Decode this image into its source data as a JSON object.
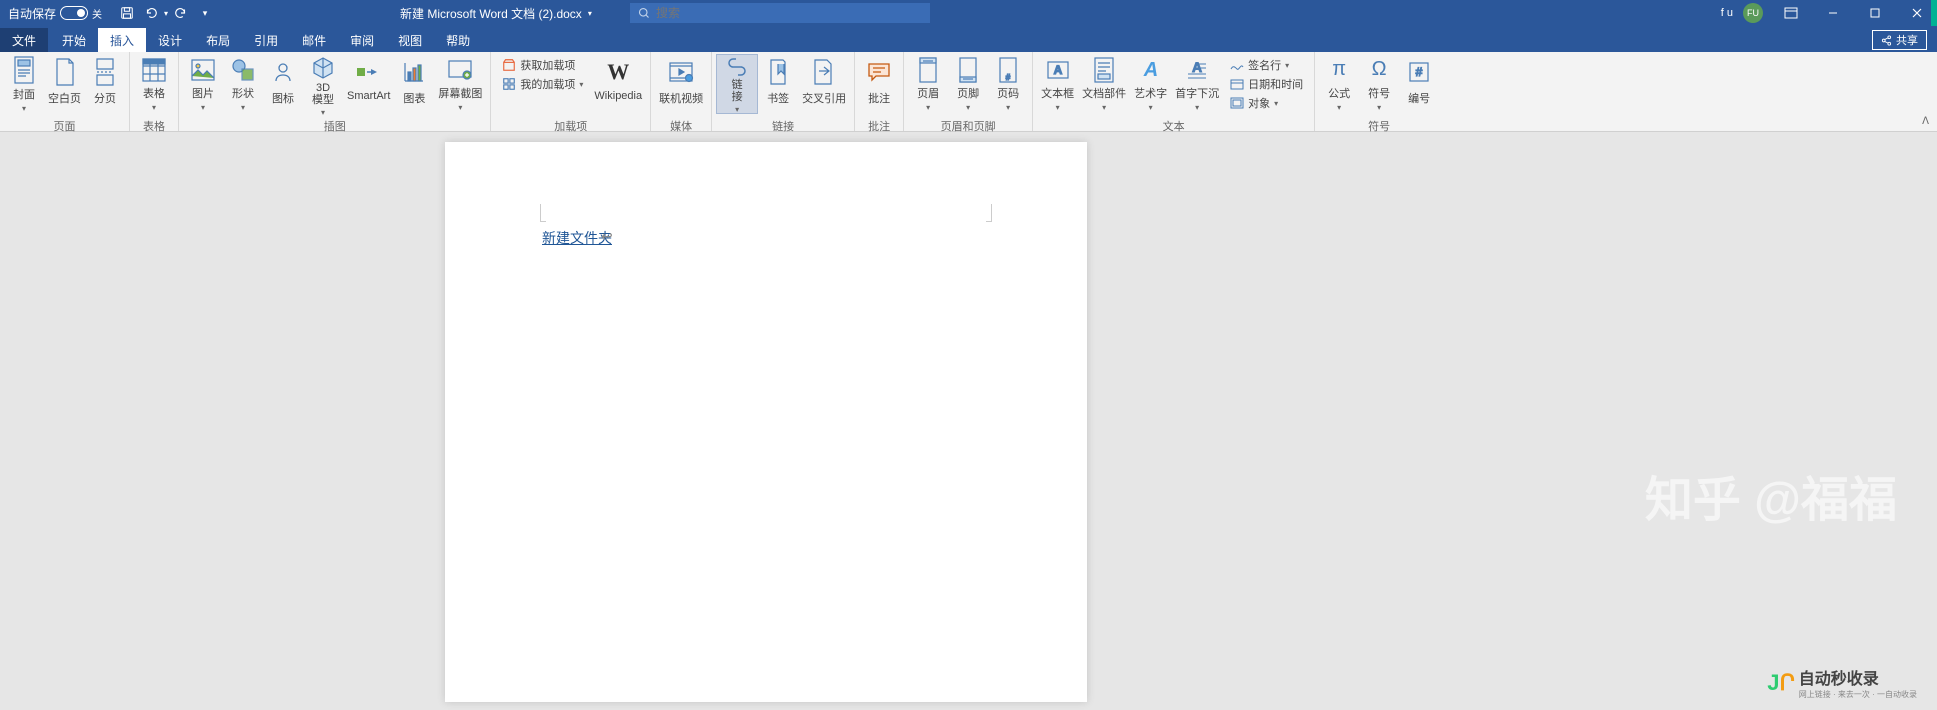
{
  "titlebar": {
    "autosave_label": "自动保存",
    "autosave_state": "关",
    "doc_title": "新建 Microsoft Word 文档 (2).docx",
    "search_placeholder": "搜索",
    "user_initials": "FU",
    "user_label": "f u"
  },
  "tabs": {
    "file": "文件",
    "items": [
      "开始",
      "插入",
      "设计",
      "布局",
      "引用",
      "邮件",
      "审阅",
      "视图",
      "帮助"
    ],
    "active": "插入",
    "share": "共享"
  },
  "ribbon": {
    "groups": {
      "pages": {
        "label": "页面",
        "cover": "封面",
        "blank": "空白页",
        "break": "分页"
      },
      "tables": {
        "label": "表格",
        "table": "表格"
      },
      "illustrations": {
        "label": "插图",
        "picture": "图片",
        "shapes": "形状",
        "icons": "图标",
        "model3d": "3D\n模型",
        "smartart": "SmartArt",
        "chart": "图表",
        "screenshot": "屏幕截图"
      },
      "addins": {
        "label": "加载项",
        "get": "获取加载项",
        "my": "我的加载项",
        "wikipedia": "Wikipedia"
      },
      "media": {
        "label": "媒体",
        "video": "联机视频"
      },
      "links": {
        "label": "链接",
        "link": "链\n接",
        "bookmark": "书签",
        "crossref": "交叉引用"
      },
      "comments": {
        "label": "批注",
        "comment": "批注"
      },
      "headerfooter": {
        "label": "页眉和页脚",
        "header": "页眉",
        "footer": "页脚",
        "pagenum": "页码"
      },
      "text": {
        "label": "文本",
        "textbox": "文本框",
        "parts": "文档部件",
        "wordart": "艺术字",
        "dropcap": "首字下沉",
        "sigline": "签名行",
        "datetime": "日期和时间",
        "object": "对象"
      },
      "symbols": {
        "label": "符号",
        "equation": "公式",
        "symbol": "符号",
        "number": "编号"
      }
    }
  },
  "document": {
    "hyperlink_text": "新建文件夹"
  },
  "watermark": {
    "zhihu": "知乎 @福福",
    "brand": "自动秒收录",
    "brand_sub": "网上链接 · 来去一次 · 一自动收录"
  }
}
